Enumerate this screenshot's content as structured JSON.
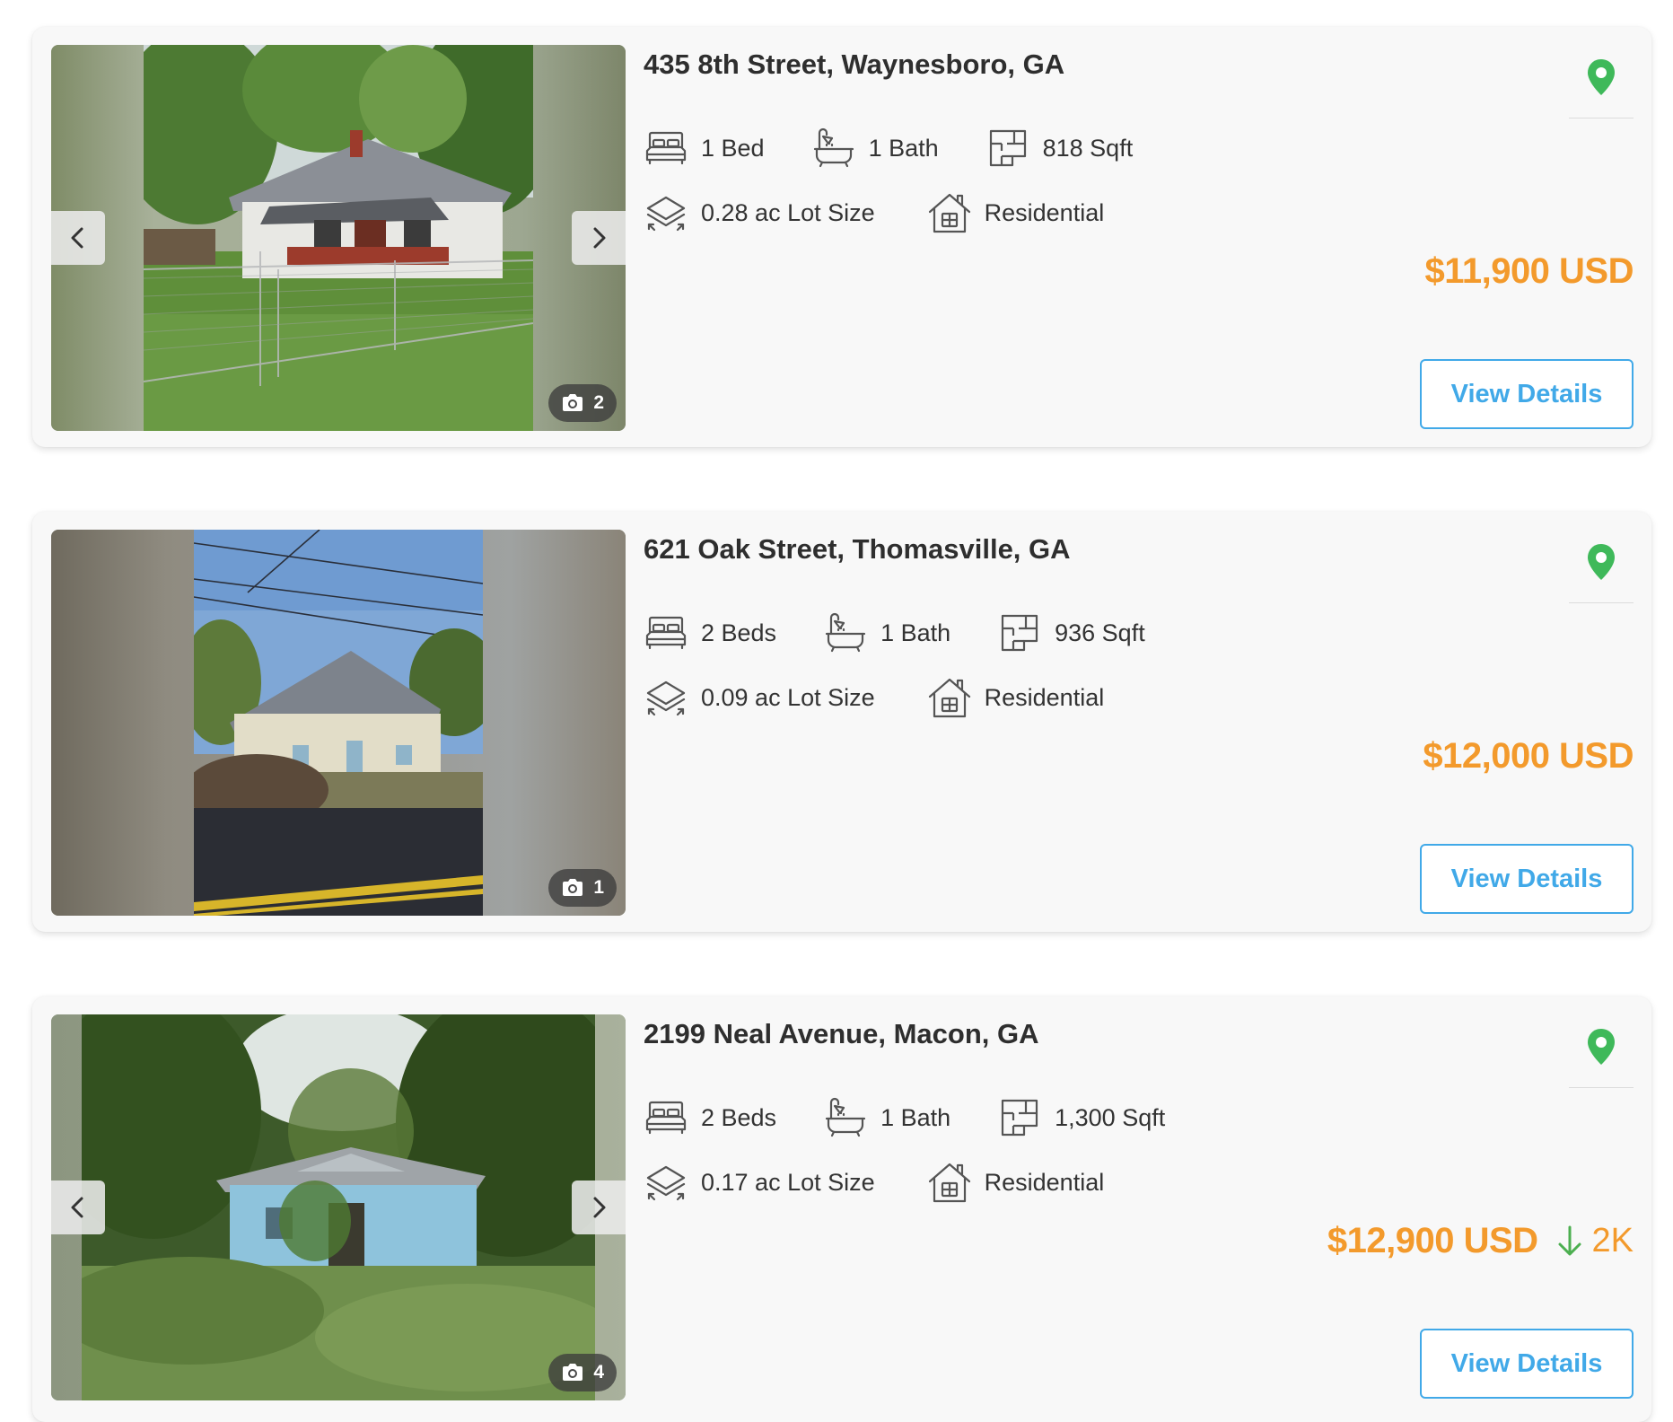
{
  "colors": {
    "price": "#f39a2c",
    "accent_blue": "#41a9e8",
    "pin_green": "#3fb95a",
    "drop_green": "#4caf50"
  },
  "icons": {
    "bed": "bed-icon",
    "bath": "bathtub-icon",
    "sqft": "floorplan-icon",
    "lot": "lot-size-icon",
    "type": "house-icon",
    "pin": "map-pin-icon",
    "camera": "camera-icon",
    "prev": "chevron-left-icon",
    "next": "chevron-right-icon",
    "drop": "arrow-down-icon"
  },
  "listings": [
    {
      "address": "435 8th Street, Waynesboro, GA",
      "beds": "1 Bed",
      "baths": "1 Bath",
      "sqft": "818 Sqft",
      "lot": "0.28 ac Lot Size",
      "type": "Residential",
      "price": "$11,900 USD",
      "photo_count": "2",
      "button": "View Details"
    },
    {
      "address": "621 Oak Street, Thomasville, GA",
      "beds": "2 Beds",
      "baths": "1 Bath",
      "sqft": "936 Sqft",
      "lot": "0.09 ac Lot Size",
      "type": "Residential",
      "price": "$12,000 USD",
      "photo_count": "1",
      "button": "View Details"
    },
    {
      "address": "2199 Neal Avenue, Macon, GA",
      "beds": "2 Beds",
      "baths": "1 Bath",
      "sqft": "1,300 Sqft",
      "lot": "0.17 ac Lot Size",
      "type": "Residential",
      "price": "$12,900 USD",
      "price_drop": "2K",
      "photo_count": "4",
      "button": "View Details"
    }
  ]
}
